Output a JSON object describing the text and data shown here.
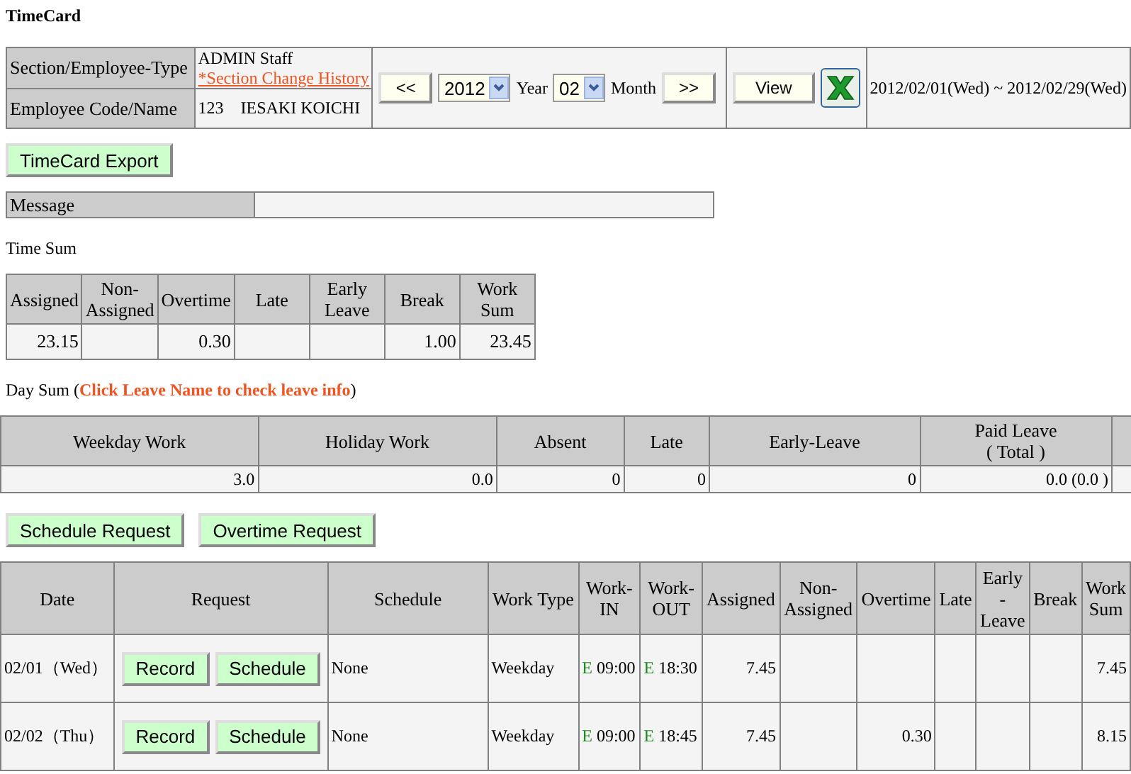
{
  "title": "TimeCard",
  "employee": {
    "section_label": "Section/Employee-Type",
    "section_value": "ADMIN Staff",
    "history_link": "*Section Change History",
    "code_label": "Employee Code/Name",
    "code_value": "123　IESAKI KOICHI"
  },
  "nav": {
    "prev": "<<",
    "year": "2012",
    "year_label": "Year",
    "month": "02",
    "month_label": "Month",
    "next": ">>",
    "view": "View",
    "range": "2012/02/01(Wed) ~ 2012/02/29(Wed)"
  },
  "export_button": "TimeCard Export",
  "message": {
    "label": "Message"
  },
  "time_sum": {
    "label": "Time Sum",
    "columns": [
      "Assigned",
      "Non-\nAssigned",
      "Overtime",
      "Late",
      "Early\nLeave",
      "Break",
      "Work\nSum"
    ],
    "values": {
      "assigned": "23.15",
      "overtime": "0.30",
      "break": "1.00",
      "work_sum": "23.45"
    }
  },
  "day_sum": {
    "label": "Day Sum (**Click Leave Name to check leave info**)",
    "columns": [
      "Weekday Work",
      "Holiday Work",
      "Absent",
      "Late",
      "Early-Leave",
      "Paid Leave\n( Total )"
    ],
    "values": [
      "3.0",
      "0.0",
      "0",
      "0",
      "0",
      "0.0 (0.0 )"
    ]
  },
  "request_buttons": [
    "Schedule Request",
    "Overtime Request"
  ],
  "timecard": {
    "columns": [
      "Date",
      "Request",
      "Schedule",
      "Work Type",
      "Work-\nIN",
      "Work-\nOUT",
      "Assigned",
      "Non-\nAssigned",
      "Overtime",
      "Late",
      "Early\n-\nLeave",
      "Break",
      "Work\nSum"
    ],
    "rows": [
      {
        "date": "02/01（Wed）",
        "buttons": [
          "Record",
          "Schedule"
        ],
        "schedule": "None",
        "work_type": "Weekday",
        "work_in": {
          "flag": "E",
          "time": "09:00"
        },
        "work_out": {
          "flag": "E",
          "time": "18:30"
        },
        "values": {
          "assigned": "7.45",
          "work_sum": "7.45"
        }
      },
      {
        "date": "02/02（Thu）",
        "buttons": [
          "Record",
          "Schedule"
        ],
        "schedule": "None",
        "work_type": "Weekday",
        "work_in": {
          "flag": "E",
          "time": "09:00"
        },
        "work_out": {
          "flag": "E",
          "time": "18:45"
        },
        "values": {
          "assigned": "7.45",
          "overtime": "0.30",
          "work_sum": "8.15"
        }
      }
    ]
  }
}
